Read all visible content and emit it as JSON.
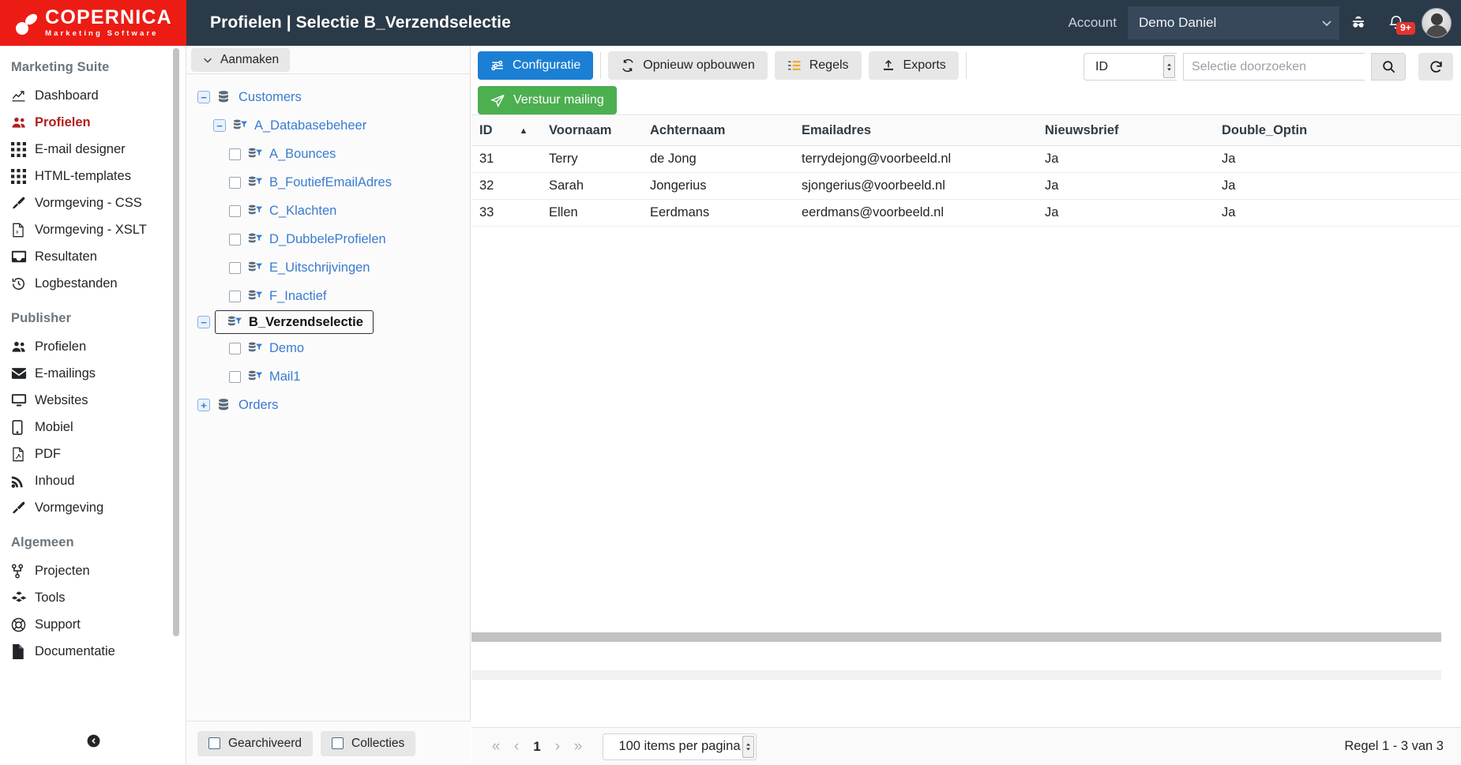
{
  "header": {
    "logo_title": "COPERNICA",
    "logo_subtitle": "Marketing Software",
    "page_title": "Profielen | Selectie B_Verzendselectie",
    "account_label": "Account",
    "account_value": "Demo Daniel",
    "notifications_badge": "9+",
    "icons": [
      "chevron-down-icon",
      "spy-icon",
      "bell-icon",
      "avatar"
    ],
    "colors": {
      "brand_red": "#ec1c15",
      "bar_dark": "#2b3a48",
      "select_bg": "#36485a"
    }
  },
  "sidebar": {
    "sections": [
      {
        "title": "Marketing Suite",
        "items": [
          {
            "label": "Dashboard",
            "icon": "chart-line-icon",
            "active": false
          },
          {
            "label": "Profielen",
            "icon": "users-icon",
            "active": true
          },
          {
            "label": "E-mail designer",
            "icon": "grid-icon",
            "active": false
          },
          {
            "label": "HTML-templates",
            "icon": "grid-icon",
            "active": false
          },
          {
            "label": "Vormgeving - CSS",
            "icon": "paintbrush-icon",
            "active": false
          },
          {
            "label": "Vormgeving - XSLT",
            "icon": "file-xslt-icon",
            "active": false
          },
          {
            "label": "Resultaten",
            "icon": "inbox-icon",
            "active": false
          },
          {
            "label": "Logbestanden",
            "icon": "history-icon",
            "active": false
          }
        ]
      },
      {
        "title": "Publisher",
        "items": [
          {
            "label": "Profielen",
            "icon": "users-icon",
            "active": false
          },
          {
            "label": "E-mailings",
            "icon": "envelope-icon",
            "active": false
          },
          {
            "label": "Websites",
            "icon": "desktop-icon",
            "active": false
          },
          {
            "label": "Mobiel",
            "icon": "tablet-icon",
            "active": false
          },
          {
            "label": "PDF",
            "icon": "file-pdf-icon",
            "active": false
          },
          {
            "label": "Inhoud",
            "icon": "rss-icon",
            "active": false
          },
          {
            "label": "Vormgeving",
            "icon": "paintbrush-icon",
            "active": false
          }
        ]
      },
      {
        "title": "Algemeen",
        "items": [
          {
            "label": "Projecten",
            "icon": "sitemap-icon",
            "active": false
          },
          {
            "label": "Tools",
            "icon": "cubes-icon",
            "active": false
          },
          {
            "label": "Support",
            "icon": "lifebuoy-icon",
            "active": false
          },
          {
            "label": "Documentatie",
            "icon": "file-icon",
            "active": false
          }
        ]
      }
    ],
    "collapse_icon": "arrow-circle-left-icon"
  },
  "tree_panel": {
    "create_button": "Aanmaken",
    "nodes": [
      {
        "label": "Customers",
        "indent": 0,
        "toggle": "minus",
        "icon": "database-icon",
        "checkbox": false,
        "selected": false
      },
      {
        "label": "A_Databasebeheer",
        "indent": 1,
        "toggle": "minus",
        "icon": "filter-db-icon",
        "checkbox": false,
        "selected": false
      },
      {
        "label": "A_Bounces",
        "indent": 2,
        "toggle": "none",
        "icon": "filter-db-icon",
        "checkbox": true,
        "selected": false
      },
      {
        "label": "B_FoutiefEmailAdres",
        "indent": 2,
        "toggle": "none",
        "icon": "filter-db-icon",
        "checkbox": true,
        "selected": false
      },
      {
        "label": "C_Klachten",
        "indent": 2,
        "toggle": "none",
        "icon": "filter-db-icon",
        "checkbox": true,
        "selected": false
      },
      {
        "label": "D_DubbeleProfielen",
        "indent": 2,
        "toggle": "none",
        "icon": "filter-db-icon",
        "checkbox": true,
        "selected": false
      },
      {
        "label": "E_Uitschrijvingen",
        "indent": 2,
        "toggle": "none",
        "icon": "filter-db-icon",
        "checkbox": true,
        "selected": false
      },
      {
        "label": "F_Inactief",
        "indent": 2,
        "toggle": "none",
        "icon": "filter-db-icon",
        "checkbox": true,
        "selected": false
      },
      {
        "label": "B_Verzendselectie",
        "indent": 1,
        "toggle": "minus",
        "icon": "filter-db-icon",
        "checkbox": false,
        "selected": true
      },
      {
        "label": "Demo",
        "indent": 2,
        "toggle": "none",
        "icon": "filter-db-icon",
        "checkbox": true,
        "selected": false
      },
      {
        "label": "Mail1",
        "indent": 2,
        "toggle": "none",
        "icon": "filter-db-icon",
        "checkbox": true,
        "selected": false
      },
      {
        "label": "Orders",
        "indent": 0,
        "toggle": "plus",
        "icon": "database-icon",
        "checkbox": false,
        "selected": false
      }
    ],
    "footer": {
      "archived_label": "Gearchiveerd",
      "collections_label": "Collecties"
    }
  },
  "main": {
    "toolbar": {
      "configuratie": "Configuratie",
      "opnieuw_opbouwen": "Opnieuw opbouwen",
      "regels": "Regels",
      "exports": "Exports",
      "verstuur_mailing": "Verstuur mailing"
    },
    "search": {
      "field_value": "ID",
      "placeholder": "Selectie doorzoeken",
      "input_value": "",
      "search_icon": "magnifier-icon",
      "refresh_icon": "refresh-icon"
    },
    "table": {
      "columns": [
        "ID",
        "Voornaam",
        "Achternaam",
        "Emailadres",
        "Nieuwsbrief",
        "Double_Optin"
      ],
      "sort_column": "ID",
      "sort_direction": "asc",
      "rows": [
        [
          "31",
          "Terry",
          "de Jong",
          "terrydejong@voorbeeld.nl",
          "Ja",
          "Ja"
        ],
        [
          "32",
          "Sarah",
          "Jongerius",
          "sjongerius@voorbeeld.nl",
          "Ja",
          "Ja"
        ],
        [
          "33",
          "Ellen",
          "Eerdmans",
          "eerdmans@voorbeeld.nl",
          "Ja",
          "Ja"
        ]
      ]
    },
    "footer": {
      "first_page": "«",
      "prev_page": "‹",
      "current_page": "1",
      "next_page": "›",
      "last_page": "»",
      "items_per_page": "100 items per pagina",
      "row_count": "Regel 1 - 3 van 3"
    }
  }
}
